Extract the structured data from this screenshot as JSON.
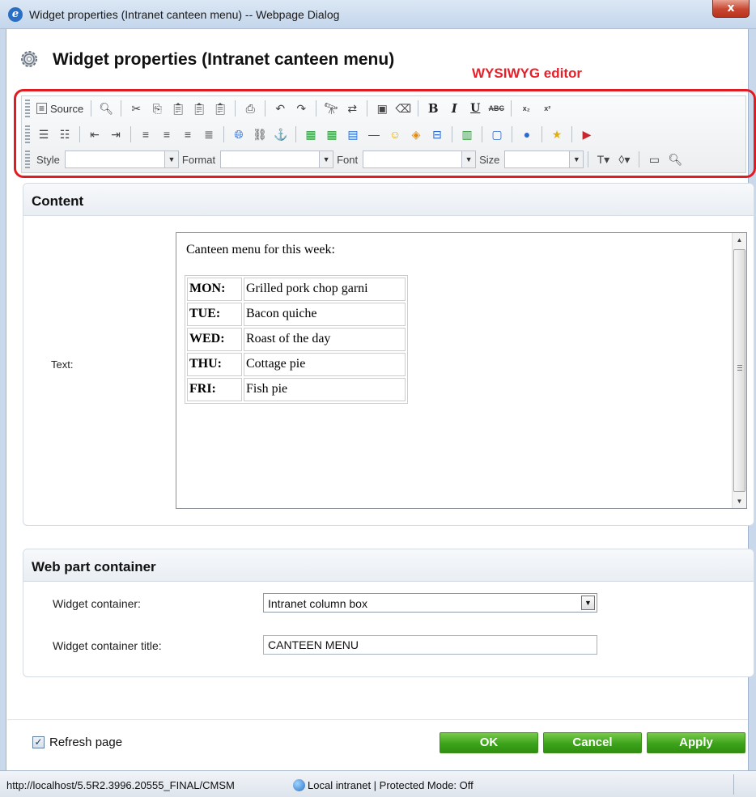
{
  "window": {
    "title": "Widget properties (Intranet canteen menu) -- Webpage Dialog",
    "close_glyph": "x"
  },
  "header": {
    "title": "Widget properties (Intranet canteen menu)",
    "annotation": "WYSIWYG editor"
  },
  "toolbar": {
    "source_label": "Source",
    "style_label": "Style",
    "format_label": "Format",
    "font_label": "Font",
    "size_label": "Size",
    "style_value": "",
    "format_value": "",
    "font_value": "",
    "size_value": ""
  },
  "content": {
    "section_title": "Content",
    "text_label": "Text:",
    "editor": {
      "intro": "Canteen menu for this week:",
      "menu": [
        {
          "day": "MON:",
          "dish": "Grilled pork chop garni"
        },
        {
          "day": "TUE:",
          "dish": "Bacon quiche"
        },
        {
          "day": "WED:",
          "dish": "Roast of the day"
        },
        {
          "day": "THU:",
          "dish": "Cottage pie"
        },
        {
          "day": "FRI:",
          "dish": "Fish pie"
        }
      ]
    }
  },
  "web_part": {
    "section_title": "Web part container",
    "container_label": "Widget container:",
    "container_value": "Intranet column box",
    "title_label": "Widget container title:",
    "title_value": "CANTEEN MENU"
  },
  "footer": {
    "refresh_label": "Refresh page",
    "refresh_checked": true,
    "ok_label": "OK",
    "cancel_label": "Cancel",
    "apply_label": "Apply"
  },
  "status": {
    "url": "http://localhost/5.5R2.3996.20555_FINAL/CMSM",
    "zone": "Local intranet | Protected Mode: Off"
  },
  "colors": {
    "annotation_red": "#e8202a",
    "button_green": "#3da31a",
    "panel_header": "#e9eef3"
  }
}
